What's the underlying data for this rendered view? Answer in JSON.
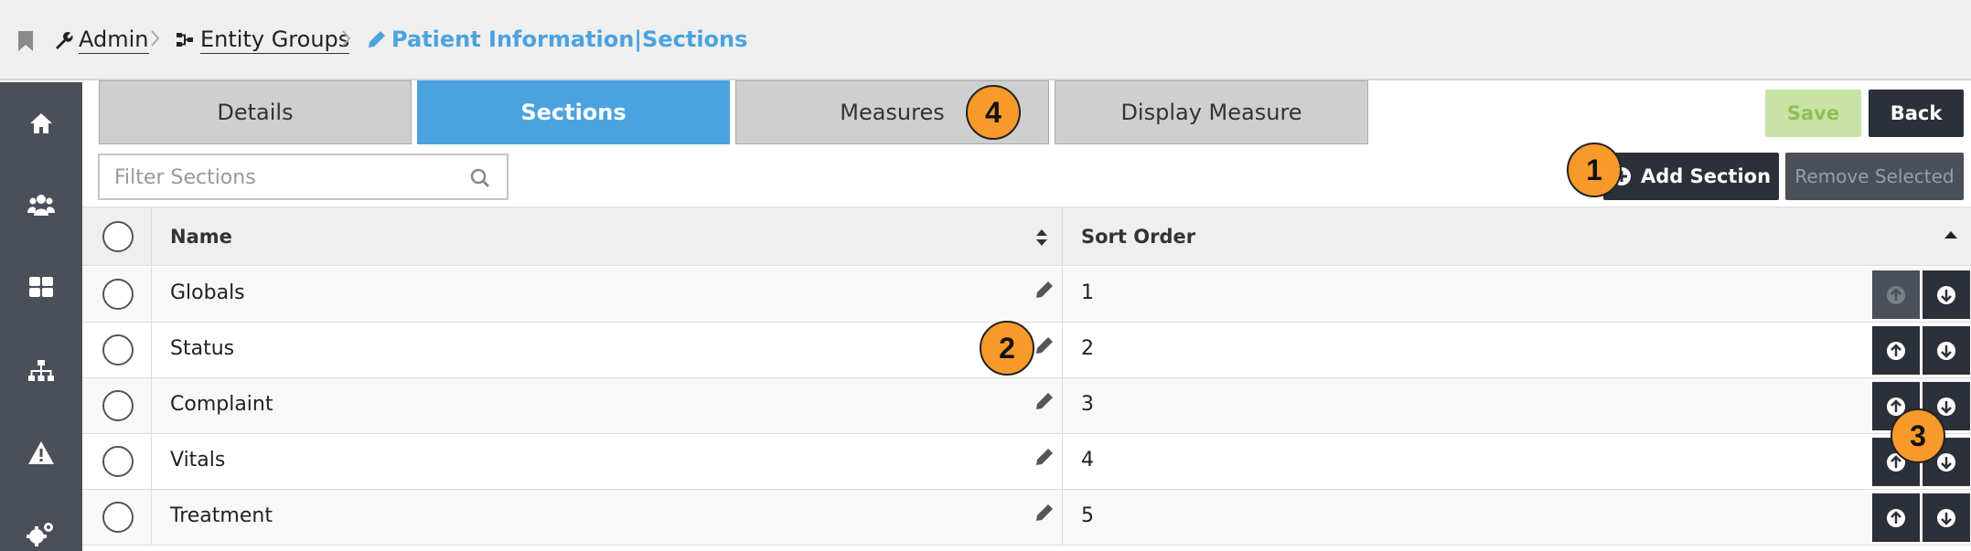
{
  "breadcrumb": {
    "admin": "Admin",
    "entity_groups": "Entity Groups",
    "current": "Patient Information|Sections"
  },
  "sidenav": {
    "items": [
      {
        "icon": "home-icon"
      },
      {
        "icon": "users-icon"
      },
      {
        "icon": "dashboard-grid-icon"
      },
      {
        "icon": "sitemap-icon"
      },
      {
        "icon": "warning-icon"
      },
      {
        "icon": "settings-gears-icon"
      }
    ]
  },
  "tabs": [
    {
      "label": "Details",
      "active": false
    },
    {
      "label": "Sections",
      "active": true
    },
    {
      "label": "Measures",
      "active": false
    },
    {
      "label": "Display Measure",
      "active": false
    }
  ],
  "toolbar": {
    "save_label": "Save",
    "back_label": "Back",
    "add_section_label": "Add Section",
    "remove_selected_label": "Remove Selected"
  },
  "filter": {
    "placeholder": "Filter Sections",
    "value": ""
  },
  "table": {
    "columns": {
      "name": "Name",
      "sort_order": "Sort Order"
    },
    "rows": [
      {
        "name": "Globals",
        "sort_order": "1",
        "up_disabled": true
      },
      {
        "name": "Status",
        "sort_order": "2",
        "up_disabled": false
      },
      {
        "name": "Complaint",
        "sort_order": "3",
        "up_disabled": false
      },
      {
        "name": "Vitals",
        "sort_order": "4",
        "up_disabled": false
      },
      {
        "name": "Treatment",
        "sort_order": "5",
        "up_disabled": false
      }
    ]
  },
  "markers": {
    "m1": "1",
    "m2": "2",
    "m3": "3",
    "m4": "4"
  },
  "colors": {
    "accent": "#4aa3df",
    "dark": "#2c3038",
    "sidenav": "#4a4f58",
    "marker": "#f79a2a",
    "save_bg": "#c9e3a4"
  }
}
